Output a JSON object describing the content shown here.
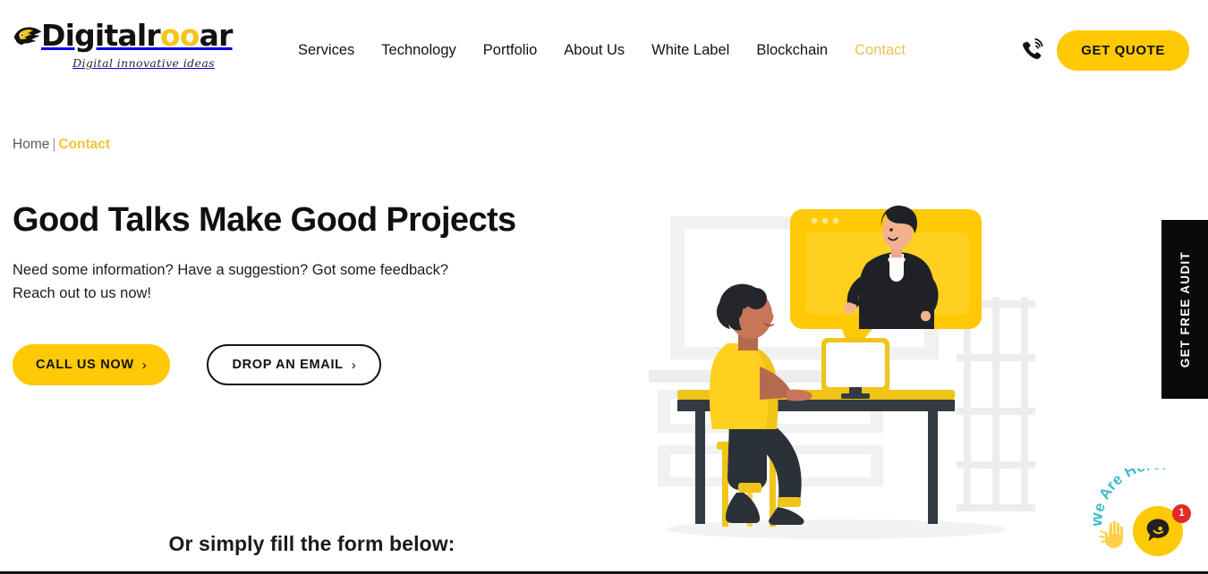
{
  "brand": {
    "logo_word_part1": "Digitalr",
    "logo_word_oo": "oo",
    "logo_word_part3": "ar",
    "logo_tagline": "Digital innovative ideas",
    "logo_icon": "roaring-tiger-icon"
  },
  "colors": {
    "accent_yellow": "#FFC905",
    "accent_yellow_soft": "#E9C24E",
    "dark": "#0a0a0a",
    "badge_red": "#E02A2A",
    "chat_teal": "#3BBCC9",
    "illus_gray": "#EDEDED"
  },
  "nav": {
    "items": [
      {
        "label": "Services",
        "active": false
      },
      {
        "label": "Technology",
        "active": false
      },
      {
        "label": "Portfolio",
        "active": false
      },
      {
        "label": "About Us",
        "active": false
      },
      {
        "label": "White Label",
        "active": false
      },
      {
        "label": "Blockchain",
        "active": false
      },
      {
        "label": "Contact",
        "active": true
      }
    ],
    "phone_icon": "phone-ring-icon",
    "quote_button": "GET QUOTE"
  },
  "breadcrumb": {
    "home": "Home",
    "separator": "|",
    "current": "Contact"
  },
  "hero": {
    "title": "Good Talks Make Good Projects",
    "sub_line1": "Need some information? Have a suggestion? Got some feedback?",
    "sub_line2": "Reach out to us now!",
    "cta_primary": "CALL US NOW",
    "cta_primary_chevron": "›",
    "cta_secondary": "DROP AN EMAIL",
    "cta_secondary_chevron": "›",
    "illustration": "video-call-at-desk-illustration"
  },
  "side_tab": {
    "label": "GET FREE AUDIT"
  },
  "chat": {
    "arc_text": "We Are Here!",
    "badge_count": "1",
    "bubble_icon": "chat-bubble-icon",
    "hand_icon": "waving-hand-icon"
  },
  "form_section": {
    "heading": "Or simply fill the form below:"
  }
}
